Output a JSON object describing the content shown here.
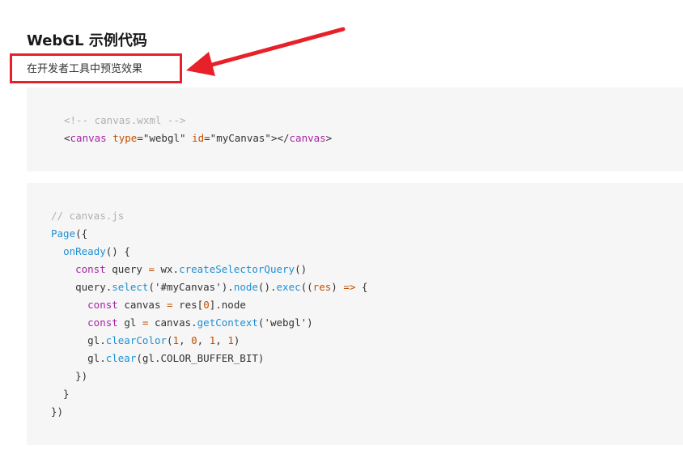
{
  "header": {
    "title": "WebGL 示例代码",
    "subtitle": "在开发者工具中预览效果"
  },
  "annotation": {
    "color": "#e8202a"
  },
  "code_block_1": {
    "lines": [
      [
        {
          "t": "<!-- canvas.wxml -->",
          "c": "comment"
        }
      ],
      [
        {
          "t": "<",
          "c": "punc"
        },
        {
          "t": "canvas",
          "c": "tag"
        },
        {
          "t": " ",
          "c": "punc"
        },
        {
          "t": "type",
          "c": "attr"
        },
        {
          "t": "=",
          "c": "punc"
        },
        {
          "t": "\"webgl\"",
          "c": "str"
        },
        {
          "t": " ",
          "c": "punc"
        },
        {
          "t": "id",
          "c": "attr"
        },
        {
          "t": "=",
          "c": "punc"
        },
        {
          "t": "\"myCanvas\"",
          "c": "str"
        },
        {
          "t": "></",
          "c": "punc"
        },
        {
          "t": "canvas",
          "c": "tag"
        },
        {
          "t": ">",
          "c": "punc"
        }
      ]
    ]
  },
  "code_block_2": {
    "lines": [
      [
        {
          "t": "// canvas.js",
          "c": "comment"
        }
      ],
      [
        {
          "t": "Page",
          "c": "fn"
        },
        {
          "t": "({",
          "c": "punc"
        }
      ],
      [
        {
          "t": "  ",
          "c": "punc"
        },
        {
          "t": "onReady",
          "c": "fn"
        },
        {
          "t": "() {",
          "c": "punc"
        }
      ],
      [
        {
          "t": "    ",
          "c": "punc"
        },
        {
          "t": "const",
          "c": "kw"
        },
        {
          "t": " query ",
          "c": "punc"
        },
        {
          "t": "=",
          "c": "attr"
        },
        {
          "t": " wx.",
          "c": "punc"
        },
        {
          "t": "createSelectorQuery",
          "c": "fn"
        },
        {
          "t": "()",
          "c": "punc"
        }
      ],
      [
        {
          "t": "    query.",
          "c": "punc"
        },
        {
          "t": "select",
          "c": "fn"
        },
        {
          "t": "(",
          "c": "punc"
        },
        {
          "t": "'#myCanvas'",
          "c": "str"
        },
        {
          "t": ").",
          "c": "punc"
        },
        {
          "t": "node",
          "c": "fn"
        },
        {
          "t": "().",
          "c": "punc"
        },
        {
          "t": "exec",
          "c": "fn"
        },
        {
          "t": "((",
          "c": "punc"
        },
        {
          "t": "res",
          "c": "attr"
        },
        {
          "t": ") ",
          "c": "punc"
        },
        {
          "t": "=>",
          "c": "attr"
        },
        {
          "t": " {",
          "c": "punc"
        }
      ],
      [
        {
          "t": "      ",
          "c": "punc"
        },
        {
          "t": "const",
          "c": "kw"
        },
        {
          "t": " canvas ",
          "c": "punc"
        },
        {
          "t": "=",
          "c": "attr"
        },
        {
          "t": " res[",
          "c": "punc"
        },
        {
          "t": "0",
          "c": "num"
        },
        {
          "t": "].node",
          "c": "punc"
        }
      ],
      [
        {
          "t": "      ",
          "c": "punc"
        },
        {
          "t": "const",
          "c": "kw"
        },
        {
          "t": " gl ",
          "c": "punc"
        },
        {
          "t": "=",
          "c": "attr"
        },
        {
          "t": " canvas.",
          "c": "punc"
        },
        {
          "t": "getContext",
          "c": "fn"
        },
        {
          "t": "(",
          "c": "punc"
        },
        {
          "t": "'webgl'",
          "c": "str"
        },
        {
          "t": ")",
          "c": "punc"
        }
      ],
      [
        {
          "t": "      gl.",
          "c": "punc"
        },
        {
          "t": "clearColor",
          "c": "fn"
        },
        {
          "t": "(",
          "c": "punc"
        },
        {
          "t": "1",
          "c": "num"
        },
        {
          "t": ", ",
          "c": "punc"
        },
        {
          "t": "0",
          "c": "num"
        },
        {
          "t": ", ",
          "c": "punc"
        },
        {
          "t": "1",
          "c": "num"
        },
        {
          "t": ", ",
          "c": "punc"
        },
        {
          "t": "1",
          "c": "num"
        },
        {
          "t": ")",
          "c": "punc"
        }
      ],
      [
        {
          "t": "      gl.",
          "c": "punc"
        },
        {
          "t": "clear",
          "c": "fn"
        },
        {
          "t": "(gl.COLOR_BUFFER_BIT)",
          "c": "punc"
        }
      ],
      [
        {
          "t": "    })",
          "c": "punc"
        }
      ],
      [
        {
          "t": "  }",
          "c": "punc"
        }
      ],
      [
        {
          "t": "})",
          "c": "punc"
        }
      ]
    ]
  }
}
